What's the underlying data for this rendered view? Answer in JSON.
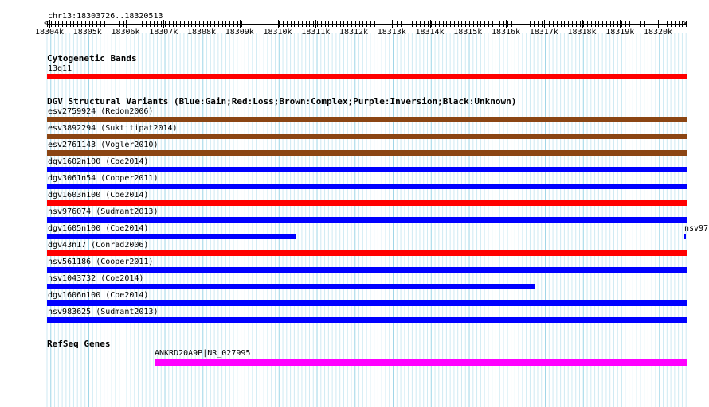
{
  "location": "chr13:18303726..18320513",
  "ruler": {
    "ticks": [
      "18304k",
      "18305k",
      "18306k",
      "18307k",
      "18308k",
      "18309k",
      "18310k",
      "18311k",
      "18312k",
      "18313k",
      "18314k",
      "18315k",
      "18316k",
      "18317k",
      "18318k",
      "18319k",
      "18320k"
    ]
  },
  "cytobands": {
    "title": "Cytogenetic Bands",
    "band": "13q11",
    "color": "#ff0000"
  },
  "dgv": {
    "title": "DGV Structural Variants (Blue:Gain;Red:Loss;Brown:Complex;Purple:Inversion;Black:Unknown)",
    "variants": [
      {
        "label": "esv2759924 (Redon2006)",
        "color": "#8b4513",
        "type": "complex"
      },
      {
        "label": "esv3892294 (Suktitipat2014)",
        "color": "#8b4513",
        "type": "complex"
      },
      {
        "label": "esv2761143 (Vogler2010)",
        "color": "#8b4513",
        "type": "complex"
      },
      {
        "label": "dgv1602n100 (Coe2014)",
        "color": "#0000ff",
        "type": "gain"
      },
      {
        "label": "dgv3061n54 (Cooper2011)",
        "color": "#0000ff",
        "type": "gain"
      },
      {
        "label": "dgv1603n100 (Coe2014)",
        "color": "#ff0000",
        "type": "loss"
      },
      {
        "label": "nsv976074 (Sudmant2013)",
        "color": "#0000ff",
        "type": "gain"
      },
      {
        "label": "dgv1605n100 (Coe2014)",
        "color": "#0000ff",
        "type": "gain",
        "truncated_end": 0.39,
        "side_label": "nsv97"
      },
      {
        "label": "dgv43n17 (Conrad2006)",
        "color": "#ff0000",
        "type": "loss"
      },
      {
        "label": "nsv561186 (Cooper2011)",
        "color": "#0000ff",
        "type": "gain"
      },
      {
        "label": "nsv1043732 (Coe2014)",
        "color": "#0000ff",
        "type": "gain",
        "truncated_end": 0.762
      },
      {
        "label": "dgv1606n100 (Coe2014)",
        "color": "#0000ff",
        "type": "gain"
      },
      {
        "label": "nsv983625 (Sudmant2013)",
        "color": "#0000ff",
        "type": "gain"
      }
    ]
  },
  "refseq": {
    "title": "RefSeq Genes",
    "gene": "ANKRD20A9P|NR_027995",
    "color": "#ff00ff",
    "start_frac": 0.168
  }
}
